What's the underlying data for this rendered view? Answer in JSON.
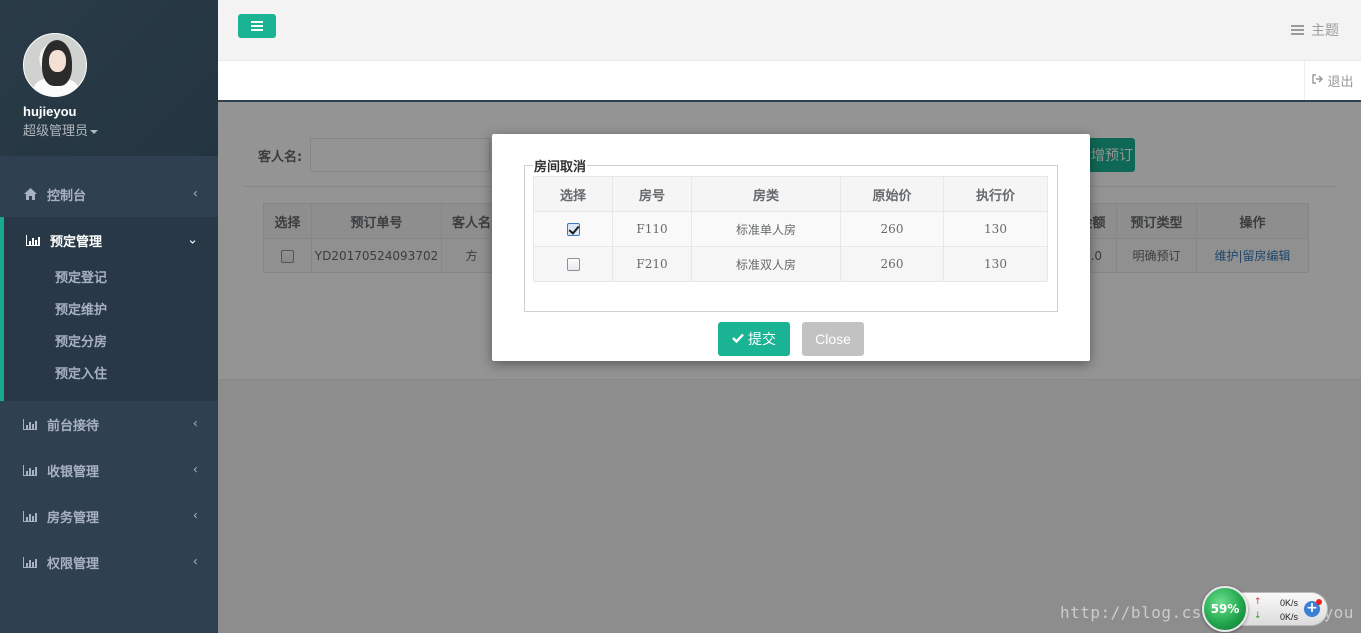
{
  "sidebar": {
    "username": "hujieyou",
    "role": "超级管理员",
    "nav": [
      {
        "label": "控制台"
      },
      {
        "label": "预定管理",
        "sub": [
          "预定登记",
          "预定维护",
          "预定分房",
          "预定入住"
        ]
      },
      {
        "label": "前台接待"
      },
      {
        "label": "收银管理"
      },
      {
        "label": "房务管理"
      },
      {
        "label": "权限管理"
      }
    ]
  },
  "topbar": {
    "theme_label": "主题",
    "logout_label": "退出"
  },
  "search": {
    "label": "客人名:",
    "add_button": "新增预订"
  },
  "main_table": {
    "headers_left": [
      "选择",
      "预订单号",
      "客人名"
    ],
    "headers_right": [
      "金额",
      "预订类型",
      "操作"
    ],
    "row": {
      "order_no": "YD20170524093702",
      "guest": "方",
      "amount": "0.0",
      "type": "明确预订",
      "ops": "维护|留房编辑"
    }
  },
  "modal": {
    "legend": "房间取消",
    "headers": [
      "选择",
      "房号",
      "房类",
      "原始价",
      "执行价"
    ],
    "rows": [
      {
        "checked": true,
        "room": "F110",
        "type": "标准单人房",
        "orig": "260",
        "exec": "130"
      },
      {
        "checked": false,
        "room": "F210",
        "type": "标准双人房",
        "orig": "260",
        "exec": "130"
      }
    ],
    "submit_label": "提交",
    "close_label": "Close"
  },
  "widget": {
    "percent": "59%",
    "up_rate": "0K/s",
    "down_rate": "0K/s",
    "watermark": "http://blog.csdn.net/hujieyou"
  },
  "colors": {
    "accent": "#1ab394",
    "sidebar": "#2f4050",
    "link": "#337ab7"
  }
}
